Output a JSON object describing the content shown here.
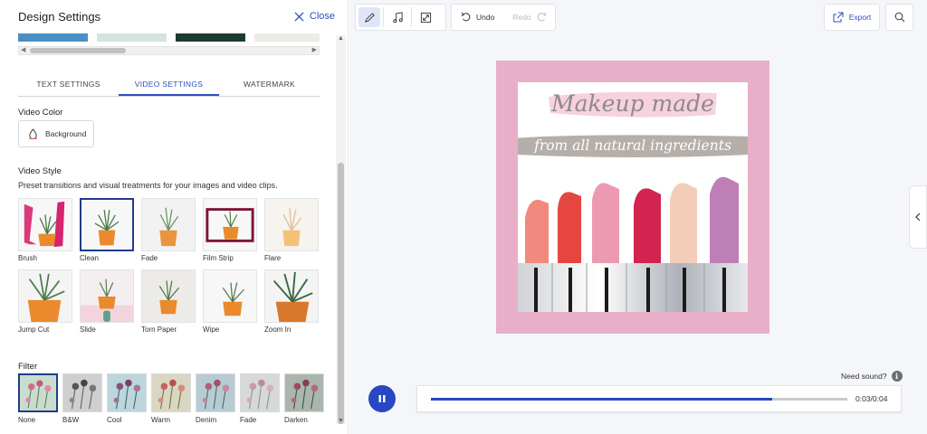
{
  "panel": {
    "title": "Design Settings",
    "close_label": "Close",
    "swatches": [
      "#4a8ec3",
      "#d4e4dd",
      "#1f3a33",
      "#ecebe6"
    ]
  },
  "tabs": [
    {
      "label": "TEXT SETTINGS",
      "active": false
    },
    {
      "label": "VIDEO SETTINGS",
      "active": true
    },
    {
      "label": "WATERMARK",
      "active": false
    }
  ],
  "video_color": {
    "label": "Video Color",
    "button_label": "Background"
  },
  "video_style": {
    "label": "Video Style",
    "description": "Preset transitions and visual treatments for your images and video clips.",
    "selected": "Clean",
    "items": [
      {
        "label": "Brush",
        "icon": "brush-style-thumbnail"
      },
      {
        "label": "Clean",
        "icon": "clean-style-thumbnail"
      },
      {
        "label": "Fade",
        "icon": "fade-style-thumbnail"
      },
      {
        "label": "Film Strip",
        "icon": "film-strip-style-thumbnail"
      },
      {
        "label": "Flare",
        "icon": "flare-style-thumbnail"
      },
      {
        "label": "Jump Cut",
        "icon": "jump-cut-style-thumbnail"
      },
      {
        "label": "Slide",
        "icon": "slide-style-thumbnail"
      },
      {
        "label": "Torn Paper",
        "icon": "torn-paper-style-thumbnail"
      },
      {
        "label": "Wipe",
        "icon": "wipe-style-thumbnail"
      },
      {
        "label": "Zoom In",
        "icon": "zoom-in-style-thumbnail"
      }
    ]
  },
  "filter": {
    "label": "Filter",
    "selected": "None",
    "items": [
      {
        "label": "None",
        "tint": "#c9dccd"
      },
      {
        "label": "B&W",
        "tint": "#cfcfcf"
      },
      {
        "label": "Cool",
        "tint": "#bcd6dc"
      },
      {
        "label": "Warm",
        "tint": "#d9d7c2"
      },
      {
        "label": "Denim",
        "tint": "#b7ccd2"
      },
      {
        "label": "Fade",
        "tint": "#d7d9d8"
      },
      {
        "label": "Darken",
        "tint": "#aab6ad"
      }
    ]
  },
  "toolbar": {
    "tools": [
      "pencil-icon",
      "music-note-icon",
      "resize-icon"
    ],
    "undo_label": "Undo",
    "redo_label": "Redo",
    "export_label": "Export"
  },
  "preview": {
    "line1": "Makeup made",
    "line2": "from all natural ingredients",
    "frame_color": "#e8afc8"
  },
  "player": {
    "need_sound": "Need sound?",
    "time": "0:03/0:04",
    "progress": 0.82,
    "state": "playing"
  },
  "colors": {
    "accent": "#2c4fb8",
    "play": "#2747c3"
  }
}
